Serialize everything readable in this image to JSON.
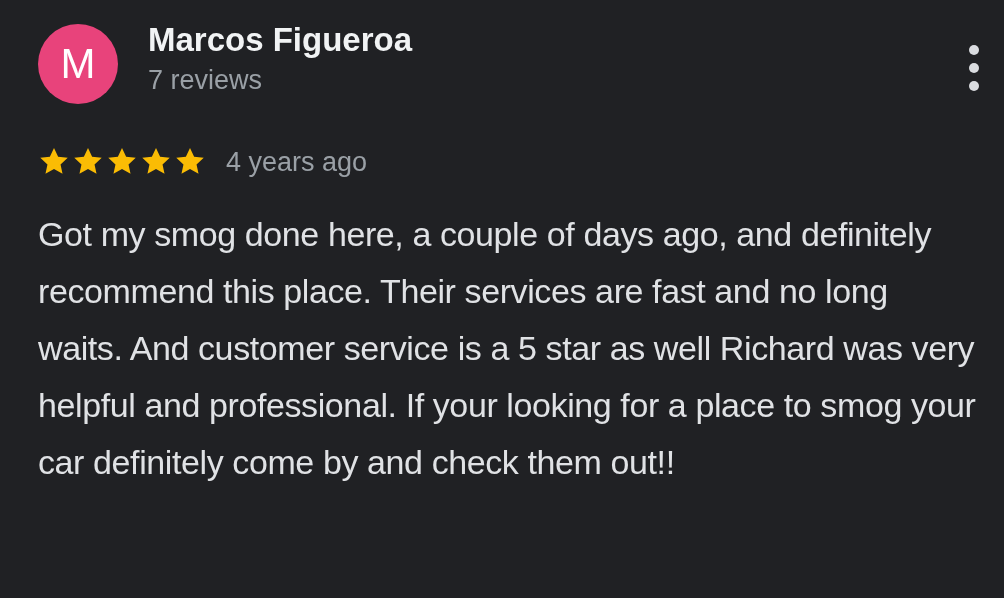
{
  "review": {
    "avatar_letter": "M",
    "author": "Marcos Figueroa",
    "reviews_count": "7 reviews",
    "stars": 5,
    "time": "4 years ago",
    "text": "Got my smog done here, a couple of days ago, and definitely recommend this place. Their services are fast and no long waits. And customer service is a 5 star as well Richard was very helpful and professional. If your looking for a place to smog your car definitely come by and check them out!!"
  }
}
